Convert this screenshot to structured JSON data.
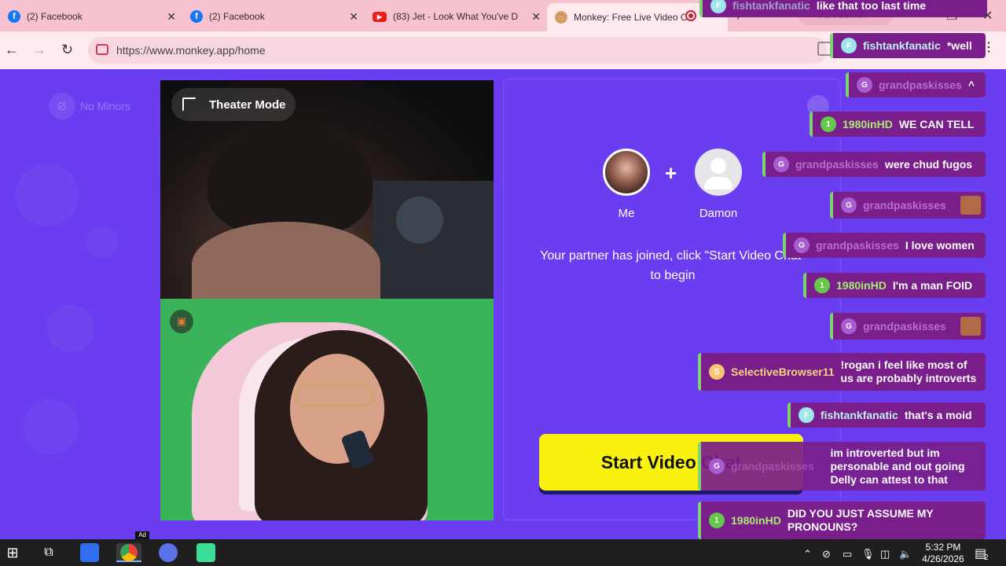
{
  "browser": {
    "tabs": [
      {
        "title": "(2) Facebook",
        "icon": "facebook-icon"
      },
      {
        "title": "(2) Facebook",
        "icon": "facebook-icon"
      },
      {
        "title": "(83) Jet - Look What You've D",
        "icon": "youtube-icon"
      },
      {
        "title": "Monkey: Free Live Video C",
        "icon": "monkey-icon",
        "active": true
      }
    ],
    "new_tab": "+",
    "gemini_label": "Ask Gemini",
    "url": "https://www.monkey.app/home"
  },
  "page": {
    "no_minors": "No Minors",
    "theater_mode": "Theater Mode",
    "me_label": "Me",
    "partner_label": "Damon",
    "joined_message": "Your partner has joined, click \"Start Video Chat\" to begin",
    "start_button": "Start Video Chat",
    "ad_label": "Ad"
  },
  "chat": [
    {
      "user": "fishtankfanatic",
      "text": "like that too last time",
      "color": "f"
    },
    {
      "user": "fishtankfanatic",
      "text": "*well",
      "color": "f"
    },
    {
      "user": "grandpaskisses",
      "text": "^",
      "color": "g"
    },
    {
      "user": "1980inHD",
      "text": "WE CAN TELL",
      "color": "1"
    },
    {
      "user": "grandpaskisses",
      "text": "were chud fugos",
      "color": "g"
    },
    {
      "user": "grandpaskisses",
      "text": "",
      "color": "g",
      "emote": true
    },
    {
      "user": "grandpaskisses",
      "text": "I love women",
      "color": "g"
    },
    {
      "user": "1980inHD",
      "text": "I'm a man FOID",
      "color": "1"
    },
    {
      "user": "grandpaskisses",
      "text": "",
      "color": "g",
      "emote": true
    },
    {
      "user": "SelectiveBrowser11",
      "text": "!rogan i feel like most of us are probably introverts",
      "color": "s"
    },
    {
      "user": "fishtankfanatic",
      "text": "that's a moid",
      "color": "f"
    },
    {
      "user": "grandpaskisses",
      "text": "im introverted but im personable and out going Delly can attest to that",
      "color": "g"
    },
    {
      "user": "1980inHD",
      "text": "DID YOU JUST ASSUME MY PRONOUNS?",
      "color": "1"
    }
  ],
  "taskbar": {
    "time": "5:32 PM",
    "date": "4/26/2026",
    "notification_count": "2"
  }
}
